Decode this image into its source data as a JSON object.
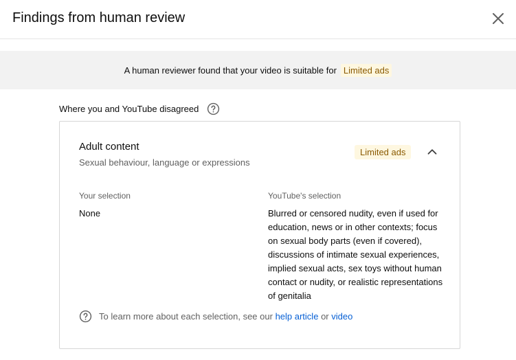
{
  "dialog": {
    "title": "Findings from human review"
  },
  "banner": {
    "text": "A human reviewer found that your video is suitable for",
    "badge": "Limited ads"
  },
  "section": {
    "label": "Where you and YouTube disagreed"
  },
  "card": {
    "title": "Adult content",
    "subtitle": "Sexual behaviour, language or expressions",
    "badge": "Limited ads",
    "your_selection_label": "Your selection",
    "your_selection_value": "None",
    "youtube_selection_label": "YouTube's selection",
    "youtube_selection_value": "Blurred or censored nudity, even if used for education, news or in other contexts; focus on sexual body parts (even if covered), discussions of intimate sexual experiences, implied sexual acts, sex toys without human contact or nudity, or realistic representations of genitalia",
    "footer_text": "To learn more about each selection, see our",
    "footer_link1": "help article",
    "footer_or": "or",
    "footer_link2": "video"
  },
  "colors": {
    "badge_bg": "#fef7e0",
    "badge_text": "#8a5a00",
    "link": "#065fd4",
    "banner_bg": "#f2f2f2"
  },
  "icons": {
    "close": "close-icon",
    "help": "help-circle-icon",
    "collapse": "chevron-up-icon"
  }
}
